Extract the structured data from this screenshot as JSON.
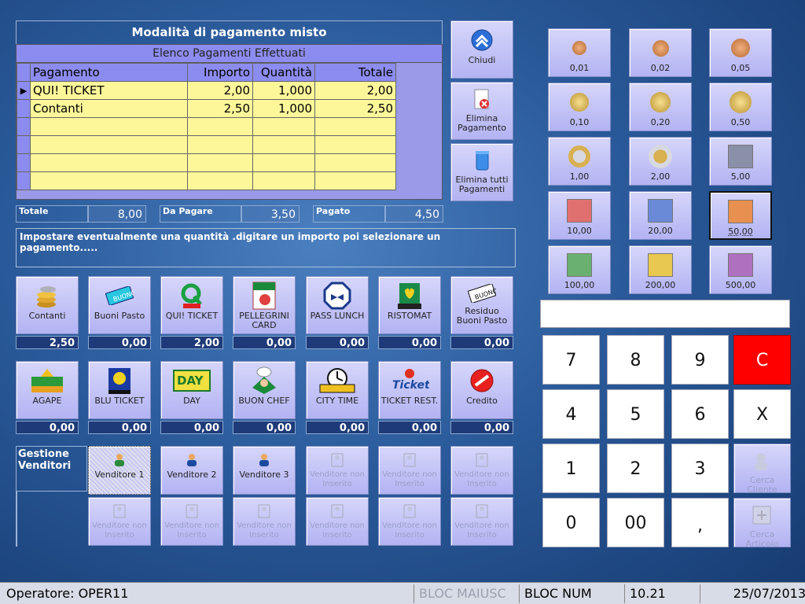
{
  "window": {
    "title": "Modalità di pagamento misto"
  },
  "grid": {
    "caption": "Elenco Pagamenti Effettuati",
    "headers": [
      "Pagamento",
      "Importo",
      "Quantità",
      "Totale"
    ],
    "rows": [
      {
        "name": "QUI! TICKET",
        "importo": "2,00",
        "quantita": "1,000",
        "totale": "2,00"
      },
      {
        "name": "Contanti",
        "importo": "2,50",
        "quantita": "1,000",
        "totale": "2,50"
      }
    ]
  },
  "summary": {
    "totale_label": "Totale",
    "totale": "8,00",
    "da_pagare_label": "Da Pagare",
    "da_pagare": "3,50",
    "pagato_label": "Pagato",
    "pagato": "4,50"
  },
  "message": "Impostare eventualmente una quantità .digitare un importo poi selezionare un pagamento.....",
  "actions": {
    "chiudi": "Chiudi",
    "elimina": "Elimina Pagamento",
    "elimina_tutti": "Elimina tutti Pagamenti"
  },
  "payments_row1": [
    {
      "label": "Contanti",
      "value": "2,50",
      "icon": "coins-icon"
    },
    {
      "label": "Buoni Pasto",
      "value": "0,00",
      "icon": "voucher-icon"
    },
    {
      "label": "QUI! TICKET",
      "value": "2,00",
      "icon": "qui-icon"
    },
    {
      "label": "PELLEGRINI CARD",
      "value": "0,00",
      "icon": "pellegrini-icon"
    },
    {
      "label": "PASS LUNCH",
      "value": "0,00",
      "icon": "passlunch-icon"
    },
    {
      "label": "RISTOMAT",
      "value": "0,00",
      "icon": "ristomat-icon"
    },
    {
      "label": "Residuo Buoni Pasto",
      "value": "0,00",
      "icon": "voucher-icon"
    }
  ],
  "payments_row2": [
    {
      "label": "AGAPE",
      "value": "0,00",
      "icon": "agape-icon"
    },
    {
      "label": "BLU TICKET",
      "value": "0,00",
      "icon": "bluticket-icon"
    },
    {
      "label": "DAY",
      "value": "0,00",
      "icon": "day-icon"
    },
    {
      "label": "BUON CHEF",
      "value": "0,00",
      "icon": "buonchef-icon"
    },
    {
      "label": "CITY TIME",
      "value": "0,00",
      "icon": "citytime-icon"
    },
    {
      "label": "TICKET REST.",
      "value": "0,00",
      "icon": "ticketrest-icon"
    },
    {
      "label": "Credito",
      "value": "0,00",
      "icon": "credit-icon"
    }
  ],
  "vendors": {
    "title": "Gestione Venditori",
    "row1": [
      "Venditore 1",
      "Venditore 2",
      "Venditore 3",
      "Venditore non Inserito",
      "Venditore non Inserito",
      "Venditore non Inserito"
    ],
    "row2": [
      "Venditore non Inserito",
      "Venditore non Inserito",
      "Venditore non Inserito",
      "Venditore non Inserito",
      "Venditore non Inserito",
      "Venditore non Inserito"
    ]
  },
  "money": [
    "0,01",
    "0,02",
    "0,05",
    "0,10",
    "0,20",
    "0,50",
    "1,00",
    "2,00",
    "5,00",
    "10,00",
    "20,00",
    "50,00",
    "100,00",
    "200,00",
    "500,00"
  ],
  "keypad": [
    "7",
    "8",
    "9",
    "C",
    "4",
    "5",
    "6",
    "X",
    "1",
    "2",
    "3",
    "0",
    "00",
    ","
  ],
  "search": {
    "cliente": "Cerca Cliente",
    "articolo": "Cerca Articolo"
  },
  "status": {
    "operatore": "Operatore: OPER11",
    "caps": "BLOC MAIUSC",
    "num": "BLOC NUM",
    "time": "10.21",
    "date": "25/07/2013"
  },
  "colors": {
    "cancel": "#ff0000",
    "cell": "#fdf79a",
    "button": "#c4c4f8"
  }
}
